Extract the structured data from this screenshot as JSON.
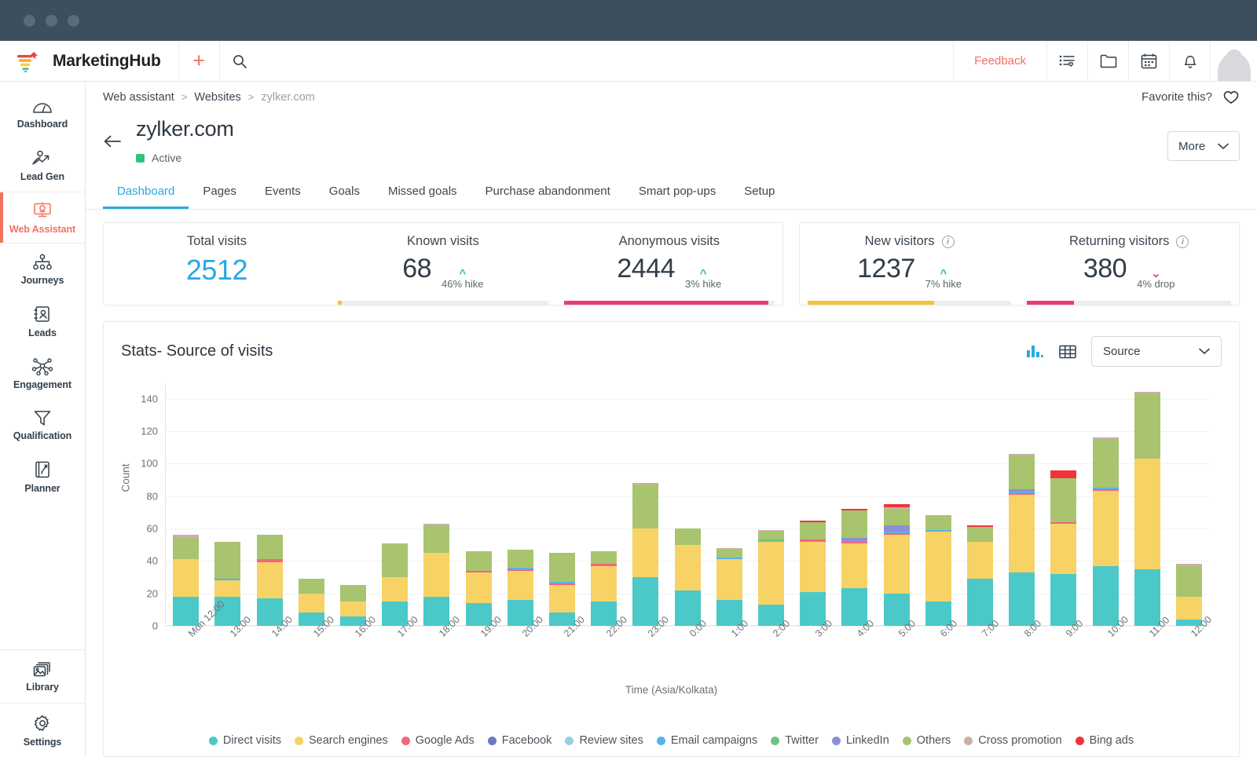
{
  "window": {
    "dots": 3
  },
  "topbar": {
    "brand": "MarketingHub",
    "add_label": "+",
    "feedback": "Feedback",
    "icons": [
      "list-heart-icon",
      "folder-icon",
      "calendar-icon",
      "bell-icon"
    ]
  },
  "sidebar": {
    "items": [
      {
        "label": "Dashboard",
        "icon": "speedometer-icon",
        "active": false
      },
      {
        "label": "Lead Gen",
        "icon": "lead-gen-icon",
        "active": false
      },
      {
        "label": "Web Assistant",
        "icon": "web-assistant-icon",
        "active": true
      },
      {
        "label": "Journeys",
        "icon": "journeys-icon",
        "active": false
      },
      {
        "label": "Leads",
        "icon": "leads-icon",
        "active": false
      },
      {
        "label": "Engagement",
        "icon": "engagement-icon",
        "active": false
      },
      {
        "label": "Qualification",
        "icon": "funnel-icon",
        "active": false
      },
      {
        "label": "Planner",
        "icon": "planner-icon",
        "active": false
      }
    ],
    "bottom": [
      {
        "label": "Library",
        "icon": "library-icon"
      },
      {
        "label": "Settings",
        "icon": "gear-icon"
      }
    ]
  },
  "breadcrumb": {
    "items": [
      "Web assistant",
      "Websites",
      "zylker.com"
    ],
    "separator": ">",
    "favorite_label": "Favorite this?"
  },
  "page": {
    "title": "zylker.com",
    "status": "Active",
    "status_color": "#2ec47d",
    "more_label": "More",
    "back_icon": "arrow-left-icon"
  },
  "tabs": [
    {
      "label": "Dashboard",
      "active": true
    },
    {
      "label": "Pages",
      "active": false
    },
    {
      "label": "Events",
      "active": false
    },
    {
      "label": "Goals",
      "active": false
    },
    {
      "label": "Missed goals",
      "active": false
    },
    {
      "label": "Purchase abandonment",
      "active": false
    },
    {
      "label": "Smart pop-ups",
      "active": false
    },
    {
      "label": "Setup",
      "active": false
    }
  ],
  "kpis": {
    "left": [
      {
        "label": "Total visits",
        "value": "2512",
        "accent": "#29a9e1",
        "delta": null,
        "bar_pct": 0,
        "bar_color": "#29a9e1",
        "has_info": false
      },
      {
        "label": "Known visits",
        "value": "68",
        "delta": "46% hike",
        "direction": "up",
        "bar_pct": 2,
        "bar_color": "#f5c33b",
        "has_info": false
      },
      {
        "label": "Anonymous visits",
        "value": "2444",
        "delta": "3% hike",
        "direction": "up",
        "bar_pct": 97,
        "bar_color": "#ec3c74",
        "has_info": false
      }
    ],
    "right": [
      {
        "label": "New visitors",
        "value": "1237",
        "delta": "7% hike",
        "direction": "up",
        "bar_pct": 62,
        "bar_color": "#f5c33b",
        "has_info": true
      },
      {
        "label": "Returning visitors",
        "value": "380",
        "delta": "4% drop",
        "direction": "down",
        "bar_pct": 23,
        "bar_color": "#ec3c74",
        "has_info": true
      }
    ]
  },
  "chart_card": {
    "title": "Stats- Source of visits",
    "view_icons": [
      "bar-chart-icon",
      "table-icon"
    ],
    "active_view": "bar-chart-icon",
    "select_value": "Source",
    "select_icon": "chevron-down-icon"
  },
  "chart_data": {
    "type": "bar",
    "stacked": true,
    "title": "Stats- Source of visits",
    "xlabel": "Time (Asia/Kolkata)",
    "ylabel": "Count",
    "ylim": [
      0,
      150
    ],
    "yticks": [
      0,
      20,
      40,
      60,
      80,
      100,
      120,
      140
    ],
    "grid": true,
    "legend_position": "bottom",
    "categories": [
      "Mon 12:00",
      "13:00",
      "14:00",
      "15:00",
      "16:00",
      "17:00",
      "18:00",
      "19:00",
      "20:00",
      "21:00",
      "22:00",
      "23:00",
      "0:00",
      "1:00",
      "2:00",
      "3:00",
      "4:00",
      "5:00",
      "6:00",
      "7:00",
      "8:00",
      "9:00",
      "10:00",
      "11:00",
      "12:00"
    ],
    "series": [
      {
        "name": "Direct visits",
        "color": "#4bc9c8",
        "values": [
          18,
          18,
          17,
          8,
          6,
          15,
          18,
          14,
          16,
          8,
          15,
          30,
          22,
          16,
          13,
          21,
          23,
          20,
          15,
          29,
          33,
          32,
          37,
          35,
          4
        ]
      },
      {
        "name": "Search engines",
        "color": "#f7d265",
        "values": [
          23,
          10,
          22,
          12,
          9,
          15,
          27,
          19,
          18,
          17,
          22,
          30,
          28,
          25,
          39,
          31,
          28,
          36,
          43,
          23,
          48,
          31,
          46,
          68,
          14
        ]
      },
      {
        "name": "Google Ads",
        "color": "#f2667c",
        "values": [
          0,
          0,
          2,
          0,
          0,
          0,
          0,
          1,
          1,
          1,
          1,
          0,
          0,
          0,
          0,
          1,
          1,
          1,
          0,
          0,
          1,
          1,
          1,
          0,
          0
        ]
      },
      {
        "name": "Facebook",
        "color": "#6b78c4",
        "values": [
          0,
          0,
          0,
          0,
          0,
          0,
          0,
          0,
          0,
          0,
          0,
          0,
          0,
          0,
          0,
          0,
          0,
          0,
          0,
          0,
          0,
          0,
          0,
          0,
          0
        ]
      },
      {
        "name": "Review sites",
        "color": "#9ccfe0",
        "values": [
          0,
          0,
          0,
          0,
          0,
          0,
          0,
          0,
          0,
          0,
          0,
          0,
          0,
          0,
          0,
          0,
          0,
          0,
          0,
          0,
          0,
          0,
          0,
          0,
          0
        ]
      },
      {
        "name": "Email campaigns",
        "color": "#56b4e8",
        "values": [
          0,
          1,
          0,
          0,
          0,
          0,
          0,
          0,
          1,
          1,
          0,
          0,
          0,
          1,
          0,
          0,
          0,
          1,
          1,
          0,
          1,
          0,
          1,
          0,
          0
        ]
      },
      {
        "name": "Twitter",
        "color": "#6fc284",
        "values": [
          0,
          0,
          0,
          0,
          0,
          0,
          0,
          0,
          0,
          0,
          0,
          0,
          0,
          0,
          1,
          0,
          0,
          0,
          0,
          0,
          0,
          0,
          0,
          0,
          0
        ]
      },
      {
        "name": "LinkedIn",
        "color": "#8d8fd6",
        "values": [
          0,
          0,
          0,
          0,
          0,
          0,
          0,
          0,
          0,
          0,
          0,
          0,
          0,
          0,
          0,
          0,
          2,
          4,
          0,
          0,
          1,
          0,
          0,
          0,
          0
        ]
      },
      {
        "name": "Others",
        "color": "#a8c46f",
        "values": [
          13,
          23,
          15,
          9,
          10,
          21,
          17,
          12,
          11,
          18,
          8,
          27,
          10,
          5,
          5,
          11,
          17,
          10,
          9,
          9,
          21,
          27,
          30,
          40,
          19
        ]
      },
      {
        "name": "Cross promotion",
        "color": "#c9b0a8",
        "values": [
          2,
          0,
          0,
          0,
          0,
          0,
          1,
          0,
          0,
          0,
          0,
          1,
          0,
          1,
          1,
          0,
          0,
          1,
          0,
          0,
          1,
          0,
          1,
          1,
          1
        ]
      },
      {
        "name": "Bing ads",
        "color": "#f0353a",
        "values": [
          0,
          0,
          0,
          0,
          0,
          0,
          0,
          0,
          0,
          0,
          0,
          0,
          0,
          0,
          0,
          1,
          1,
          2,
          0,
          1,
          0,
          5,
          0,
          0,
          0
        ]
      }
    ]
  }
}
